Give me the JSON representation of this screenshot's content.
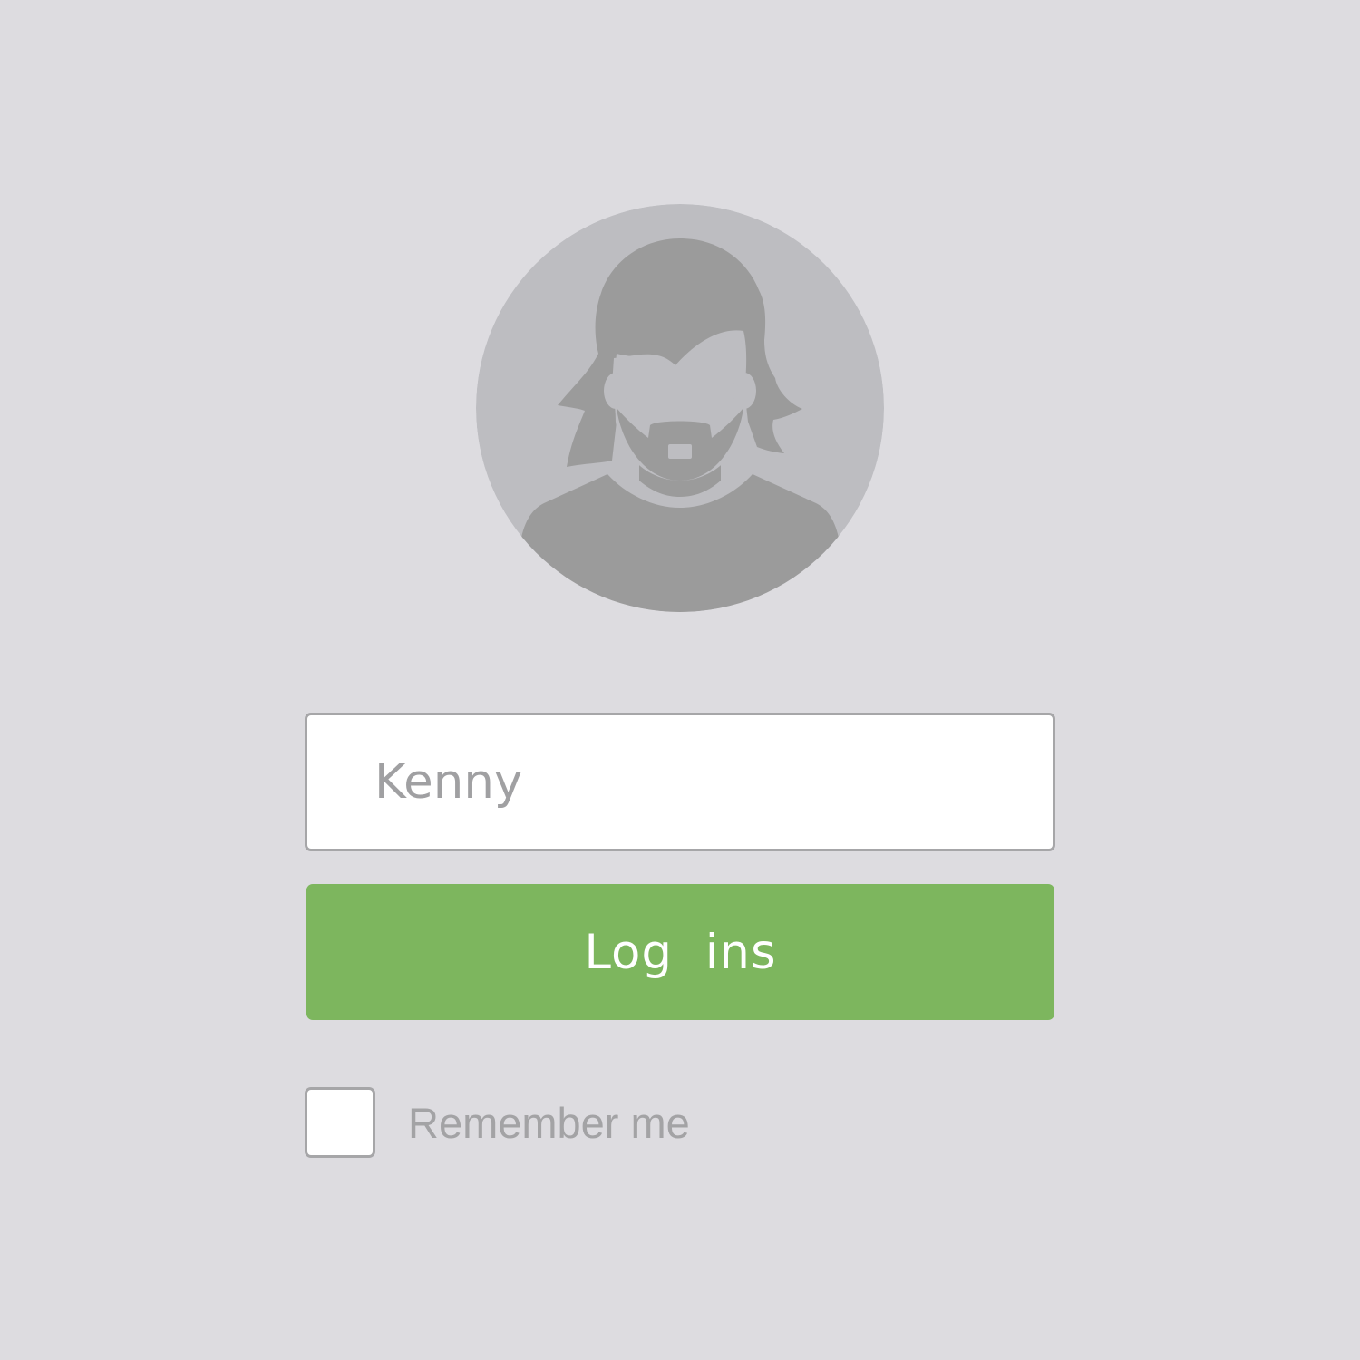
{
  "colors": {
    "background": "#dddce0",
    "avatar_circle": "#bdbdc1",
    "avatar_silhouette": "#9b9b9b",
    "input_background": "#ffffff",
    "input_border": "#a6a6a8",
    "text_muted": "#a0a0a2",
    "button_green": "#7db65e",
    "button_text": "#ffffff"
  },
  "avatar": {
    "icon": "default-user-silhouette-icon"
  },
  "login_form": {
    "username_value": "Kenny",
    "login_button_label": "Log  ins",
    "remember_label": "Remember me",
    "remember_checked": false
  }
}
